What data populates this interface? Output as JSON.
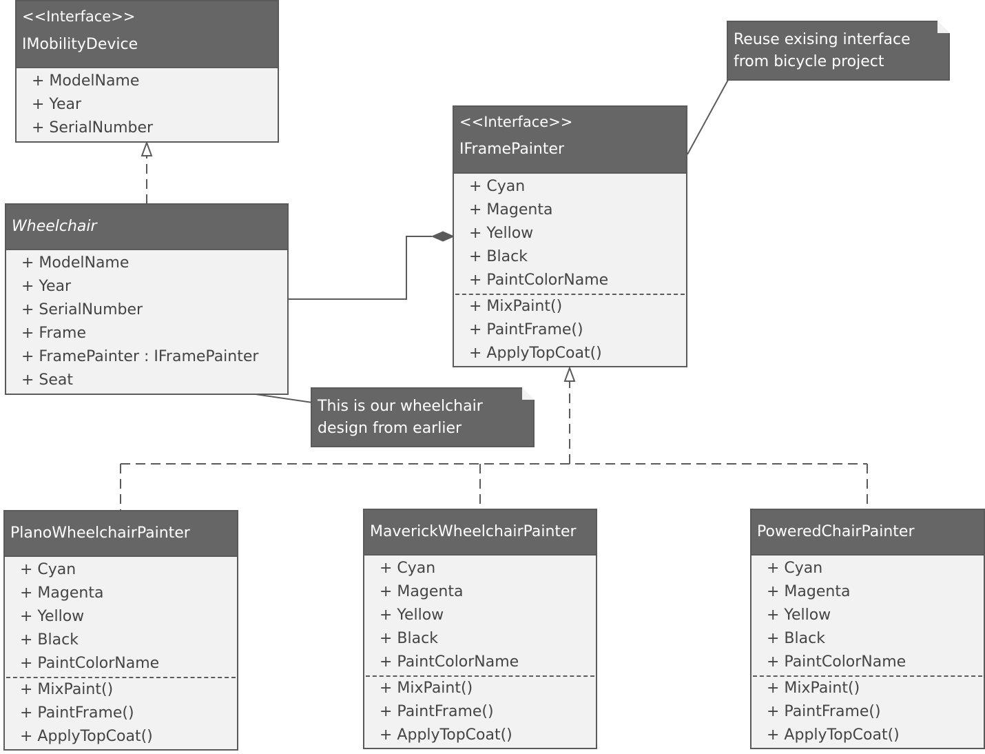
{
  "diagram": {
    "type": "UML class diagram",
    "colors": {
      "header_bg": "#666666",
      "body_bg": "#f2f2f2",
      "border": "#5a5a5a",
      "header_text": "#ffffff",
      "member_text": "#444444"
    },
    "classes": {
      "imobility": {
        "stereotype": "<<Interface>>",
        "name": "IMobilityDevice",
        "attributes": [
          "+ ModelName",
          "+ Year",
          "+ SerialNumber"
        ],
        "operations": []
      },
      "wheelchair": {
        "stereotype": "",
        "name": "Wheelchair",
        "abstract": true,
        "attributes": [
          "+ ModelName",
          "+ Year",
          "+ SerialNumber",
          "+ Frame",
          "+ FramePainter : IFramePainter",
          "+ Seat"
        ],
        "operations": []
      },
      "iframepainter": {
        "stereotype": "<<Interface>>",
        "name": "IFramePainter",
        "attributes": [
          "+ Cyan",
          "+ Magenta",
          "+ Yellow",
          "+ Black",
          "+ PaintColorName"
        ],
        "operations": [
          "+ MixPaint()",
          "+ PaintFrame()",
          "+ ApplyTopCoat()"
        ]
      },
      "plano": {
        "name": "PlanoWheelchairPainter",
        "attributes": [
          "+ Cyan",
          "+ Magenta",
          "+ Yellow",
          "+ Black",
          "+ PaintColorName"
        ],
        "operations": [
          "+ MixPaint()",
          "+ PaintFrame()",
          "+ ApplyTopCoat()"
        ]
      },
      "maverick": {
        "name": "MaverickWheelchairPainter",
        "attributes": [
          "+ Cyan",
          "+ Magenta",
          "+ Yellow",
          "+ Black",
          "+ PaintColorName"
        ],
        "operations": [
          "+ MixPaint()",
          "+ PaintFrame()",
          "+ ApplyTopCoat()"
        ]
      },
      "powered": {
        "name": "PoweredChairPainter",
        "attributes": [
          "+ Cyan",
          "+ Magenta",
          "+ Yellow",
          "+ Black",
          "+ PaintColorName"
        ],
        "operations": [
          "+ MixPaint()",
          "+ PaintFrame()",
          "+ ApplyTopCoat()"
        ]
      }
    },
    "notes": {
      "reuse": [
        "Reuse exising interface",
        "from bicycle project"
      ],
      "wheelchair": [
        "This is our wheelchair",
        "design from earlier"
      ]
    },
    "relationships": [
      {
        "type": "realization",
        "from": "Wheelchair",
        "to": "IMobilityDevice"
      },
      {
        "type": "composition",
        "from": "Wheelchair",
        "to": "IFramePainter"
      },
      {
        "type": "realization",
        "from": "PlanoWheelchairPainter",
        "to": "IFramePainter"
      },
      {
        "type": "realization",
        "from": "MaverickWheelchairPainter",
        "to": "IFramePainter"
      },
      {
        "type": "realization",
        "from": "PoweredChairPainter",
        "to": "IFramePainter"
      },
      {
        "type": "note-anchor",
        "from": "Reuse exising interface note",
        "to": "IFramePainter"
      },
      {
        "type": "note-anchor",
        "from": "This is our wheelchair note",
        "to": "Wheelchair"
      }
    ]
  }
}
